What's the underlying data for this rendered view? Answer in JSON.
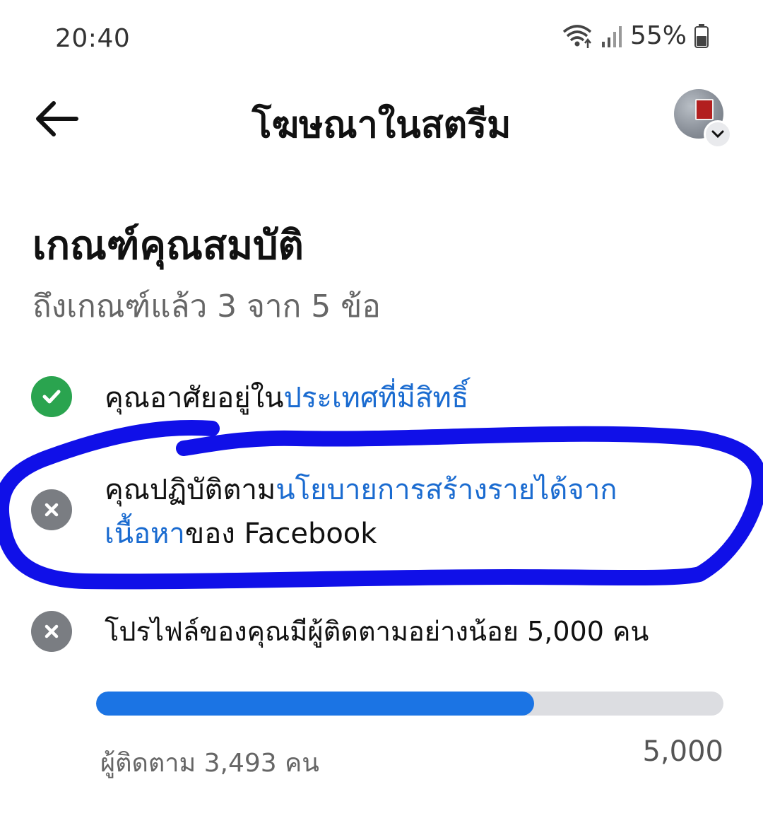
{
  "status_bar": {
    "time": "20:40",
    "battery_percent": "55%",
    "icons": [
      "wifi-icon",
      "signal-icon",
      "battery-icon"
    ]
  },
  "header": {
    "title": "โฆษณาในสตรีม",
    "back_icon": "arrow-left-icon",
    "avatar_icon": "profile-avatar",
    "badge_icon": "chevron-down-icon"
  },
  "section": {
    "title": "เกณฑ์คุณสมบัติ",
    "subtitle": "ถึงเกณฑ์แล้ว 3 จาก 5 ข้อ"
  },
  "criteria": [
    {
      "status": "met",
      "icon": "check-icon",
      "text_before": "คุณอาศัยอยู่ใน",
      "link_text": "ประเทศที่มีสิทธิ์",
      "text_after": ""
    },
    {
      "status": "not_met",
      "icon": "close-icon",
      "text_before": "คุณปฏิบัติตาม",
      "link_text": "นโยบายการสร้างรายได้จากเนื้อหา",
      "text_after": "ของ Facebook"
    },
    {
      "status": "not_met",
      "icon": "close-icon",
      "text_before": "โปรไฟล์ของคุณมีผู้ติดตามอย่างน้อย 5,000 คน",
      "link_text": "",
      "text_after": ""
    }
  ],
  "followers": {
    "current": 3493,
    "target": 5000,
    "progress_fraction": 0.6986,
    "label": "ผู้ติดตาม 3,493 คน",
    "target_label": "5,000"
  },
  "colors": {
    "accent": "#1b74e4",
    "link": "#1a6bd0",
    "success": "#2aa44f",
    "muted_icon": "#7a7d82",
    "annotation": "#1010e8"
  }
}
